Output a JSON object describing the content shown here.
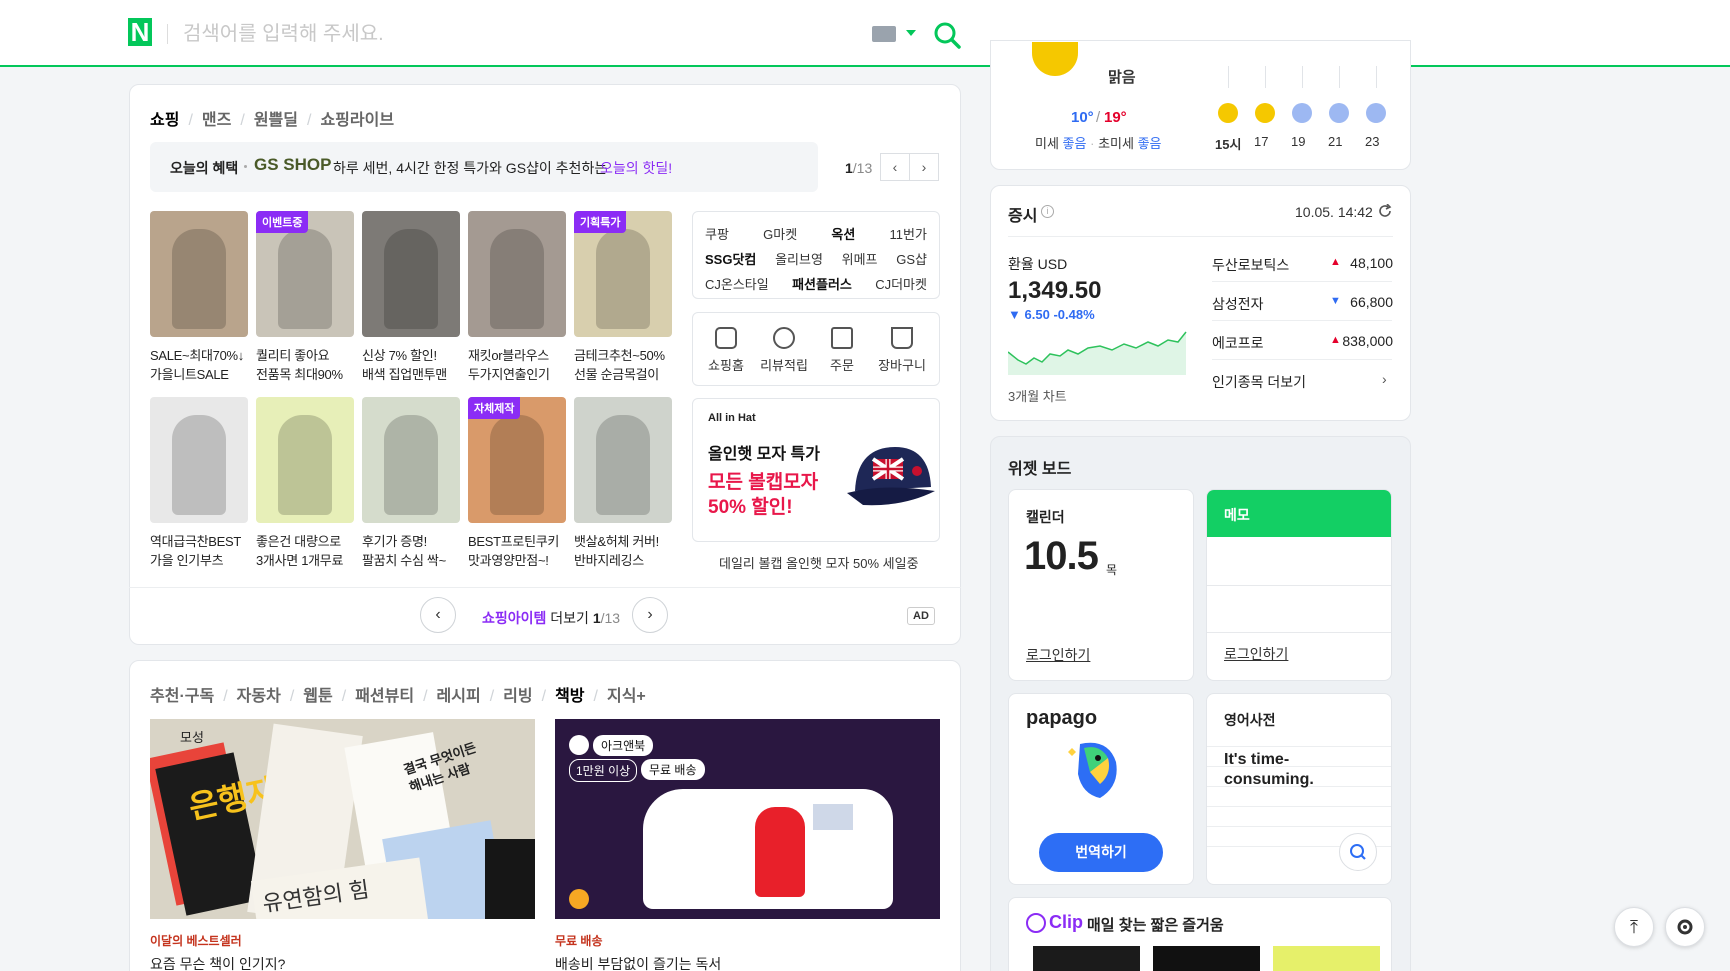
{
  "header": {
    "logo": "N",
    "search_placeholder": "검색어를 입력해 주세요."
  },
  "shopping": {
    "tabs": [
      "쇼핑",
      "맨즈",
      "원쁠딜",
      "쇼핑라이브"
    ],
    "benefit": {
      "label": "오늘의 혜택",
      "brand": "GS SHOP",
      "text": "하루 세번, 4시간 한정 특가와 GS샵이 추천하는",
      "highlight": "오늘의 핫딜!",
      "page_current": "1",
      "page_total": "/13"
    },
    "products_row1": [
      {
        "line1": "SALE~최대70%↓",
        "line2": "가을니트SALE",
        "badge": "",
        "color": "#b9a48c"
      },
      {
        "line1": "퀄리티 좋아요",
        "line2": "전품목 최대90%",
        "badge": "이벤트중",
        "color": "#c9c4b8"
      },
      {
        "line1": "신상 7% 할인!",
        "line2": "배색 집업맨투맨",
        "badge": "",
        "color": "#7d7a76"
      },
      {
        "line1": "재킷or블라우스",
        "line2": "두가지연출인기",
        "badge": "",
        "color": "#a49a92"
      },
      {
        "line1": "금테크추천~50%",
        "line2": "선물 순금목걸이",
        "badge": "기획특가",
        "color": "#d8cfae"
      }
    ],
    "products_row2": [
      {
        "line1": "역대급극찬BEST",
        "line2": "가을 인기부츠",
        "badge": "",
        "color": "#e8e8e8"
      },
      {
        "line1": "좋은건 대량으로",
        "line2": "3개사면 1개무료",
        "badge": "",
        "color": "#e7efb8"
      },
      {
        "line1": "후기가 증명!",
        "line2": "팔꿈치 수심 싹~",
        "badge": "",
        "color": "#d5dccc"
      },
      {
        "line1": "BEST프로틴쿠키",
        "line2": "맛과영양만점~!",
        "badge": "자체제작",
        "color": "#d99a6a"
      },
      {
        "line1": "뱃살&허체 커버!",
        "line2": "반바지레깅스",
        "badge": "",
        "color": "#cfd3cc"
      }
    ],
    "malls": [
      [
        "쿠팡",
        "G마켓",
        "옥션",
        "11번가"
      ],
      [
        "SSG닷컴",
        "올리브영",
        "위메프",
        "GS샵"
      ],
      [
        "CJ온스타일",
        "패션플러스",
        "CJ더마켓"
      ]
    ],
    "quick_links": [
      "쇼핑홈",
      "리뷰적립",
      "주문",
      "장바구니"
    ],
    "ad_banner": {
      "brand": "All in Hat",
      "title": "올인햇 모자 특가",
      "highlight1": "모든 볼캡모자",
      "highlight2": "50% 할인!",
      "caption": "데일리 볼캡 올인햇 모자 50% 세일중"
    },
    "footer": {
      "label_bold": "쇼핑아이템",
      "label": "더보기",
      "page_current": "1",
      "page_total": "/13",
      "ad": "AD"
    }
  },
  "contents": {
    "tabs": [
      "추천·구독",
      "자동차",
      "웹툰",
      "패션뷰티",
      "레시피",
      "리빙",
      "책방",
      "지식+"
    ],
    "active_tab": "책방",
    "cards": [
      {
        "tag": "이달의 베스트셀러",
        "title": "요즘 무슨 책이 인기지?"
      },
      {
        "tag": "무료 배송",
        "title": "배송비 부담없이 즐기는 독서"
      }
    ],
    "book_texts": [
      "모성",
      "은행자",
      "유연함의 힘",
      "결국 무엇이든 해내는 사람"
    ],
    "promo_labels": [
      "아크앤북",
      "1만원 이상",
      "무료 배송"
    ]
  },
  "weather": {
    "condition": "맑음",
    "temp_low": "10°",
    "temp_high": "19°",
    "dust_label": "미세",
    "dust_value": "좋음",
    "fine_dust_label": "초미세",
    "fine_dust_value": "좋음",
    "hours": [
      {
        "time": "15시",
        "icon": "sun-icon"
      },
      {
        "time": "17",
        "icon": "sun-icon"
      },
      {
        "time": "19",
        "icon": "moon-icon"
      },
      {
        "time": "21",
        "icon": "moon-icon"
      },
      {
        "time": "23",
        "icon": "moon-icon"
      }
    ]
  },
  "stocks": {
    "title": "증시",
    "time": "10.05. 14:42",
    "fx_label": "환율 USD",
    "fx_value": "1,349.50",
    "fx_change": "6.50",
    "fx_pct": "-0.48%",
    "chart_label": "3개월 차트",
    "items": [
      {
        "name": "두산로보틱스",
        "value": "48,100",
        "dir": "up"
      },
      {
        "name": "삼성전자",
        "value": "66,800",
        "dir": "down"
      },
      {
        "name": "에코프로",
        "value": "838,000",
        "dir": "up"
      }
    ],
    "more": "인기종목 더보기"
  },
  "widget": {
    "title": "위젯 보드",
    "calendar_title": "캘린더",
    "calendar_date": "10.5",
    "calendar_day": "목",
    "calendar_login": "로그인하기",
    "memo_title": "메모",
    "memo_login": "로그인하기",
    "papago_title": "papago",
    "papago_button": "번역하기",
    "dict_title": "영어사전",
    "dict_text": "It's time-consuming.",
    "clip_brand": "Clip",
    "clip_text": "매일 찾는 짧은 즐거움"
  },
  "colors": {
    "brand": "#03c75a",
    "purple": "#8b2cf5",
    "up": "#e4002b",
    "down": "#2f6bf2"
  }
}
